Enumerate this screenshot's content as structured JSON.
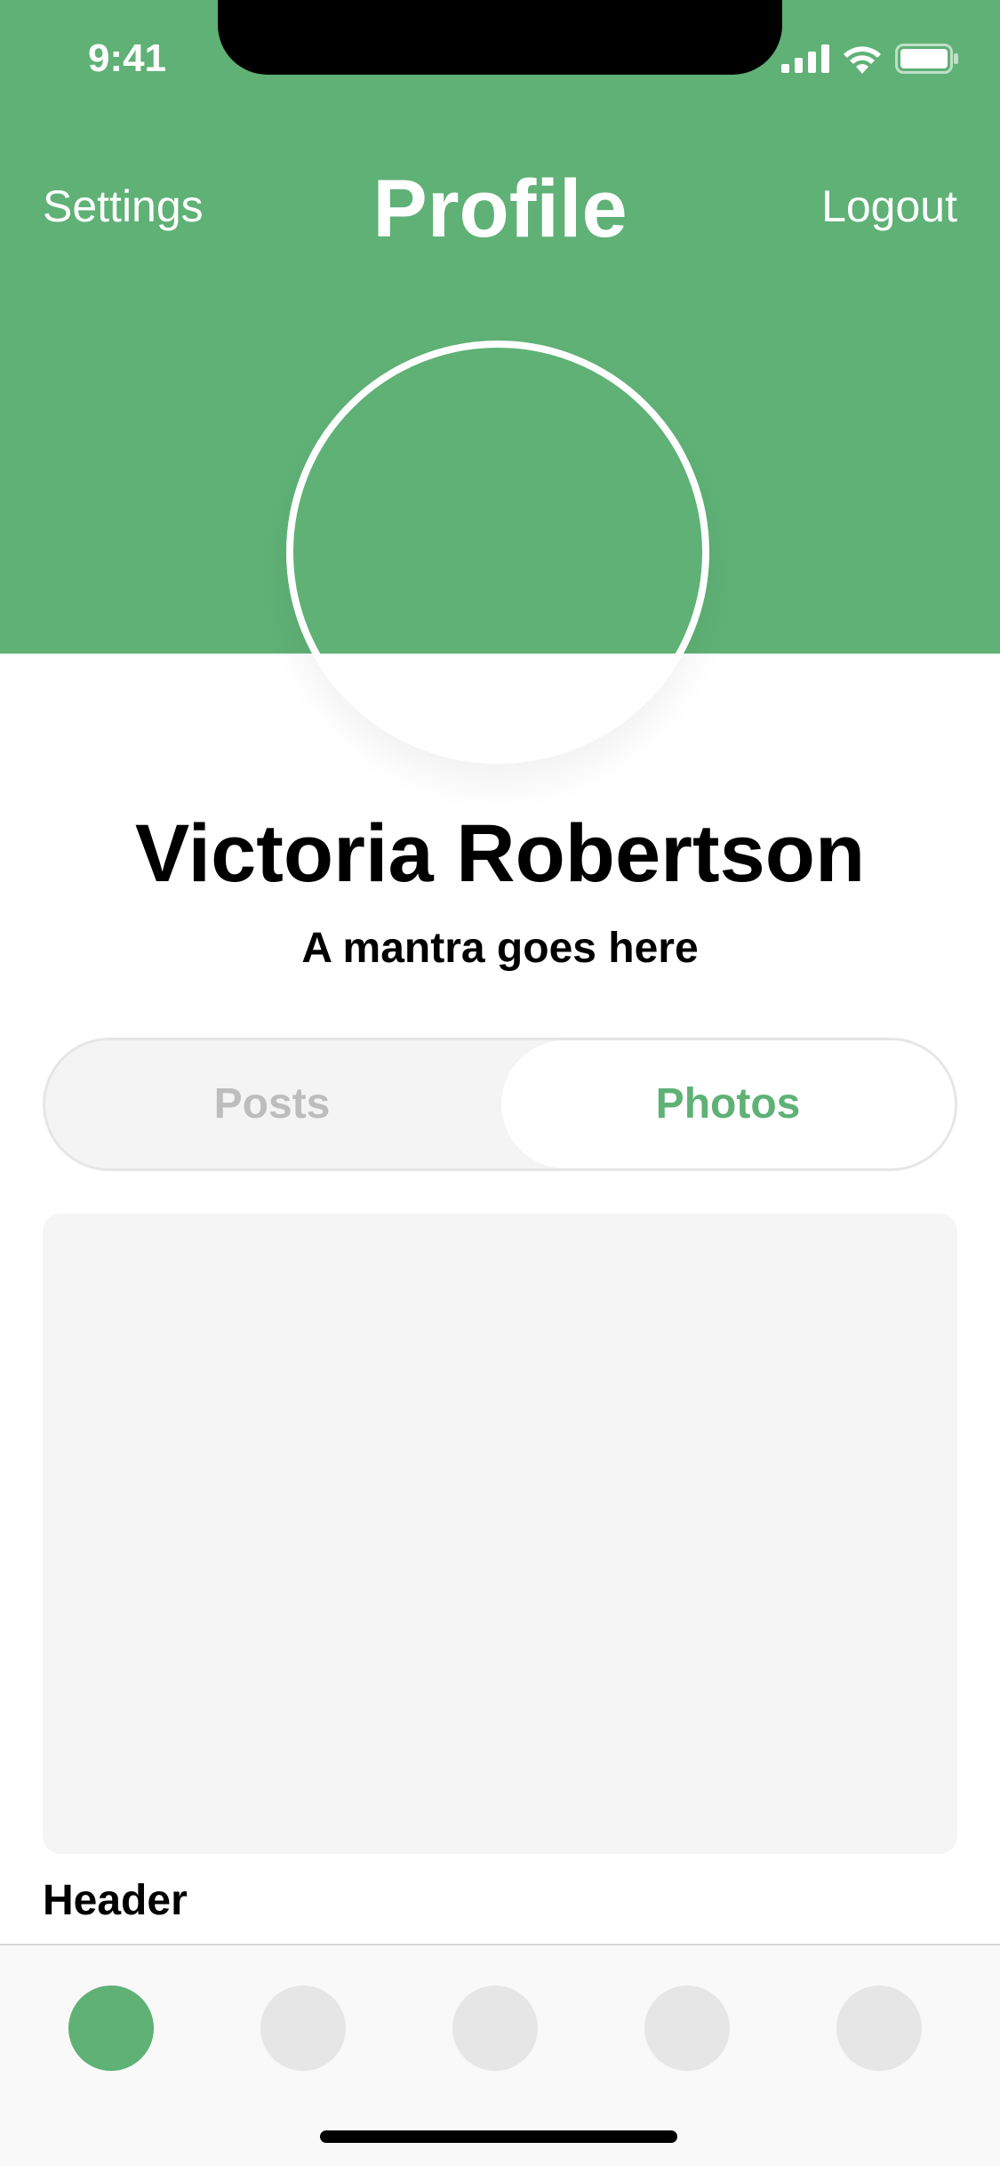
{
  "status_bar": {
    "time": "9:41",
    "icons": [
      "cellular-signal-icon",
      "wifi-icon",
      "battery-icon"
    ]
  },
  "nav": {
    "left_label": "Settings",
    "title": "Profile",
    "right_label": "Logout"
  },
  "profile": {
    "name": "Victoria Robertson",
    "mantra": "A mantra goes here"
  },
  "segmented": {
    "tabs": [
      {
        "label": "Posts",
        "selected": false
      },
      {
        "label": "Photos",
        "selected": true
      }
    ]
  },
  "content": {
    "header": "Header"
  },
  "tab_bar": {
    "items": [
      {
        "icon": "tab-1-icon",
        "active": true
      },
      {
        "icon": "tab-2-icon",
        "active": false
      },
      {
        "icon": "tab-3-icon",
        "active": false
      },
      {
        "icon": "tab-4-icon",
        "active": false
      },
      {
        "icon": "tab-5-icon",
        "active": false
      }
    ]
  },
  "colors": {
    "accent": "#5fb176",
    "inactive_tab": "#e6e6e6",
    "muted_text": "#bdbdbd",
    "card_bg": "#f5f5f5"
  }
}
